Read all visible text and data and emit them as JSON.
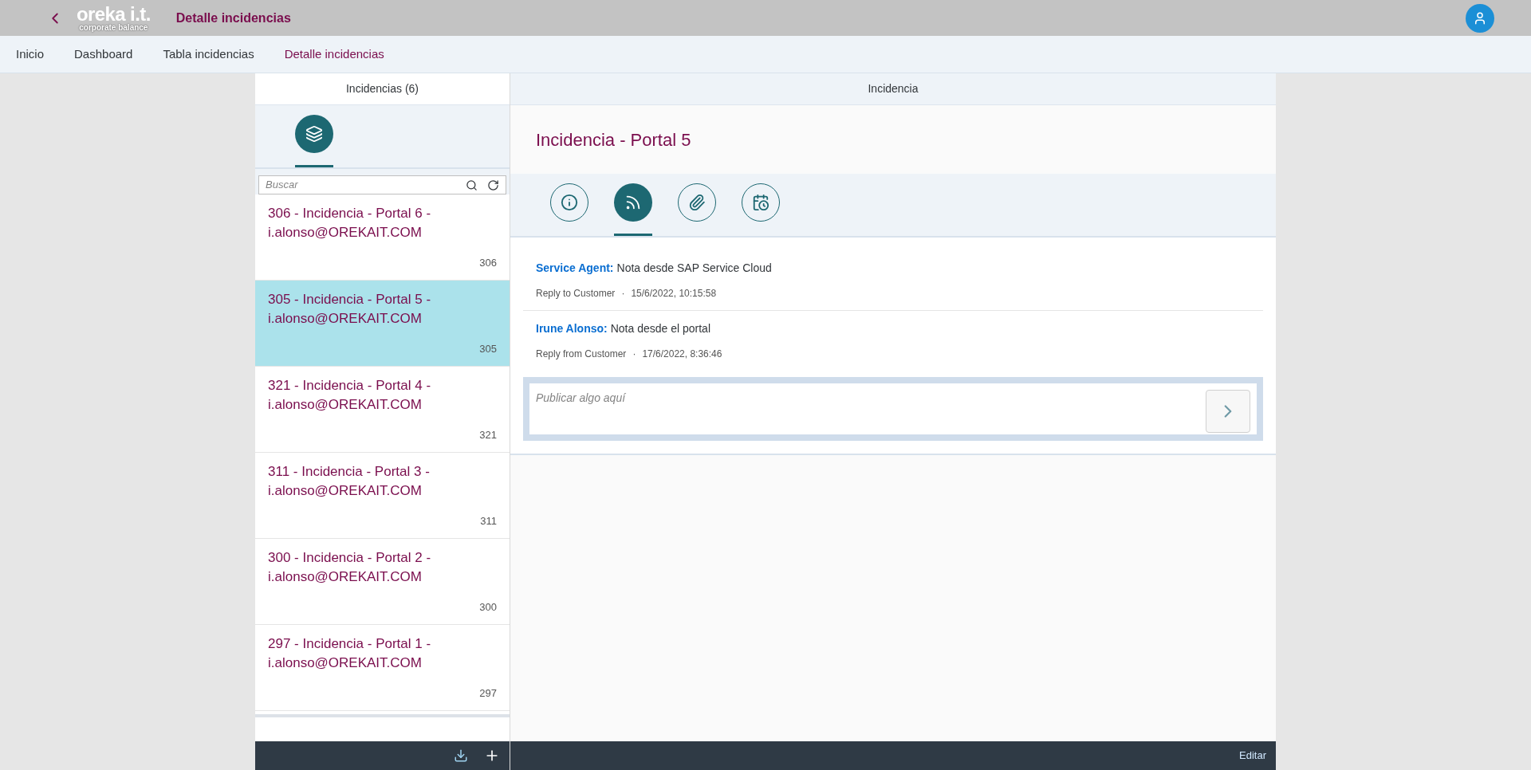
{
  "header": {
    "logo": "oreka i.t.",
    "logo_tagline": "corporate balance",
    "title": "Detalle incidencias"
  },
  "breadcrumbs": [
    {
      "label": "Inicio",
      "selected": false
    },
    {
      "label": "Dashboard",
      "selected": false
    },
    {
      "label": "Tabla incidencias",
      "selected": false
    },
    {
      "label": "Detalle incidencias",
      "selected": true
    }
  ],
  "master": {
    "title": "Incidencias (6)",
    "tabs": [
      {
        "kind": "layers",
        "selected": true
      }
    ],
    "search": {
      "placeholder": "Buscar"
    },
    "items": [
      {
        "title": "306 - Incidencia - Portal 6 - i.alonso@OREKAIT.COM",
        "number": "306",
        "selected": false
      },
      {
        "title": "305 - Incidencia - Portal 5 - i.alonso@OREKAIT.COM",
        "number": "305",
        "selected": true
      },
      {
        "title": "321 - Incidencia - Portal 4 - i.alonso@OREKAIT.COM",
        "number": "321",
        "selected": false
      },
      {
        "title": "311 - Incidencia - Portal 3 - i.alonso@OREKAIT.COM",
        "number": "311",
        "selected": false
      },
      {
        "title": "300 - Incidencia - Portal 2 - i.alonso@OREKAIT.COM",
        "number": "300",
        "selected": false
      },
      {
        "title": "297 - Incidencia - Portal 1 - i.alonso@OREKAIT.COM",
        "number": "297",
        "selected": false
      }
    ]
  },
  "detail": {
    "title": "Incidencia",
    "object_title": "Incidencia - Portal 5",
    "tabs": [
      {
        "kind": "info",
        "selected": false
      },
      {
        "kind": "feed",
        "selected": true
      },
      {
        "kind": "attachment",
        "selected": false
      },
      {
        "kind": "schedule",
        "selected": false
      }
    ],
    "feed": [
      {
        "author": "Service Agent:",
        "text": "Nota desde SAP Service Cloud",
        "type": "Reply to Customer",
        "separator": "·",
        "timestamp": "15/6/2022, 10:15:58"
      },
      {
        "author": "Irune Alonso:",
        "text": "Nota desde el portal",
        "type": "Reply from Customer",
        "separator": "·",
        "timestamp": "17/6/2022, 8:36:46"
      }
    ],
    "post": {
      "placeholder": "Publicar algo aquí"
    },
    "footer": {
      "button": "Editar"
    }
  }
}
